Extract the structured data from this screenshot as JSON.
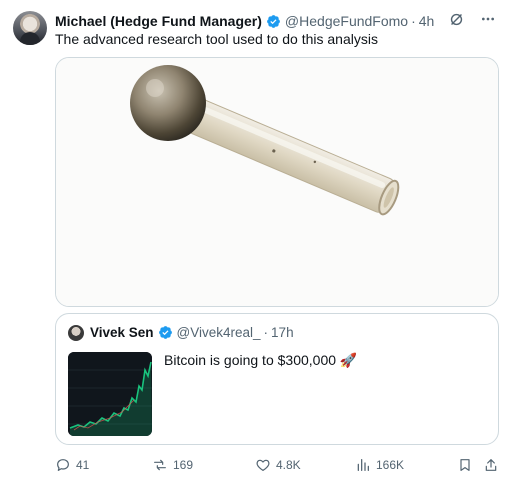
{
  "tweet": {
    "author_name": "Michael (Hedge Fund Manager)",
    "handle": "@HedgeFundFomo",
    "separator": "·",
    "time": "4h",
    "text": "The advanced research tool used to do this analysis"
  },
  "quoted_tweet": {
    "author_name": "Vivek Sen",
    "handle": "@Vivek4real_",
    "separator": "·",
    "time": "17h",
    "text": "Bitcoin is going to $300,000 🚀"
  },
  "actions": {
    "replies": "41",
    "reposts": "169",
    "likes": "4.8K",
    "views": "166K"
  },
  "colors": {
    "verified": "#1d9bf0",
    "muted_text": "#536471",
    "border": "#cfd9de",
    "chart_line": "#19c37d"
  },
  "icons": [
    "verified-badge-icon",
    "grok-icon",
    "more-icon",
    "reply-icon",
    "repost-icon",
    "like-icon",
    "views-icon",
    "bookmark-icon",
    "share-icon",
    "rocket-emoji"
  ]
}
